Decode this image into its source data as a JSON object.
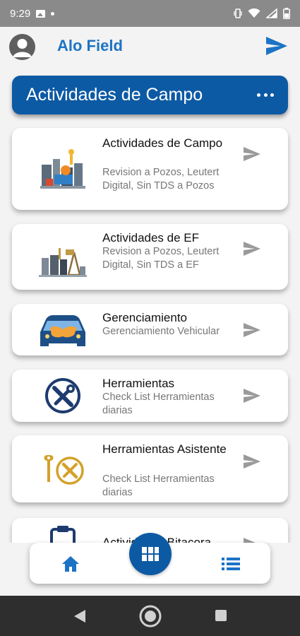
{
  "status_bar": {
    "time": "9:29"
  },
  "header": {
    "app_title": "Alo Field"
  },
  "section": {
    "title": "Actividades de Campo"
  },
  "cards": [
    {
      "title": "Actividades de Campo",
      "subtitle": "Revision a Pozos, Leutert Digital, Sin TDS a Pozos",
      "icon": "oil-field-icon"
    },
    {
      "title": "Actividades de EF",
      "subtitle": "Revision a Pozos, Leutert Digital, Sin TDS a EF",
      "icon": "pump-station-icon"
    },
    {
      "title": "Gerenciamiento",
      "subtitle": "Gerenciamiento Vehicular",
      "icon": "car-handshake-icon"
    },
    {
      "title": "Herramientas",
      "subtitle": "Check List Herramientas diarias",
      "icon": "tools-icon"
    },
    {
      "title": "Herramientas Asistente",
      "subtitle": "Check List Herramientas diarias",
      "icon": "tools-assistant-icon"
    },
    {
      "title": "Actividades Bitacora",
      "subtitle": "",
      "icon": "clipboard-icon"
    }
  ],
  "colors": {
    "primary": "#0d5aa4",
    "accent": "#1c73c5",
    "send_gray": "#9a9a9a"
  }
}
